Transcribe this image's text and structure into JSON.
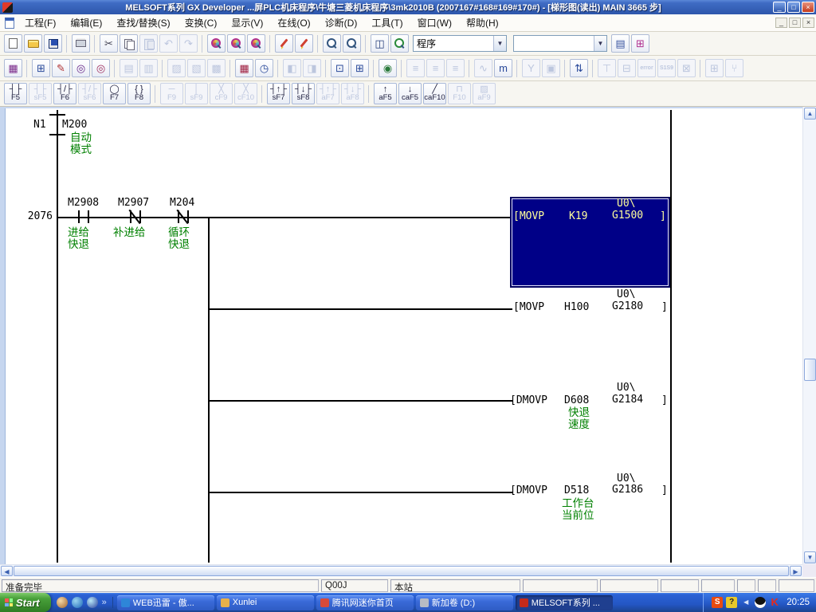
{
  "window": {
    "title": "MELSOFT系列 GX Developer ...屏PLC机床程序\\牛塘三菱机床程序\\3mk2010B    (2007167#168#169#170#) - [梯形图(读出)    MAIN    3665 步]",
    "controls": {
      "minimize": "_",
      "restore": "□",
      "close": "×"
    }
  },
  "menu": {
    "items": [
      "工程(F)",
      "编辑(E)",
      "查找/替换(S)",
      "变换(C)",
      "显示(V)",
      "在线(O)",
      "诊断(D)",
      "工具(T)",
      "窗口(W)",
      "帮助(H)"
    ],
    "mdi_controls": {
      "minimize": "_",
      "restore": "□",
      "close": "×"
    }
  },
  "toolbar_main": {
    "buttons": [
      {
        "name": "new-project",
        "icon": "page",
        "enabled": true
      },
      {
        "name": "open-project",
        "icon": "folder",
        "enabled": true
      },
      {
        "name": "save-project",
        "icon": "floppy",
        "enabled": true
      },
      {
        "sep": true
      },
      {
        "name": "print",
        "icon": "printer",
        "enabled": true
      },
      {
        "sep": true
      },
      {
        "name": "cut",
        "icon": "glyph:✂",
        "enabled": true,
        "color": "#445"
      },
      {
        "name": "copy",
        "icon": "copy",
        "enabled": true
      },
      {
        "name": "paste",
        "icon": "paste",
        "enabled": false
      },
      {
        "name": "undo",
        "icon": "glyph:↶",
        "enabled": false
      },
      {
        "name": "redo",
        "icon": "glyph:↷",
        "enabled": false
      },
      {
        "sep": true
      },
      {
        "name": "find",
        "icon": "mag-colorful",
        "enabled": true
      },
      {
        "name": "find-device",
        "icon": "mag-colorful",
        "enabled": true
      },
      {
        "name": "find-string",
        "icon": "mag-colorful",
        "enabled": true
      },
      {
        "sep": true
      },
      {
        "name": "device-comment-edit",
        "icon": "pencil",
        "enabled": true
      },
      {
        "name": "device-memory-edit",
        "icon": "pencil",
        "enabled": true
      },
      {
        "sep": true
      },
      {
        "name": "zoom-out",
        "icon": "mag",
        "enabled": true
      },
      {
        "name": "zoom-in",
        "icon": "mag",
        "enabled": true
      },
      {
        "sep": true
      },
      {
        "name": "tile-windows",
        "icon": "glyph:◫",
        "enabled": true
      },
      {
        "name": "refresh-monitor",
        "icon": "mag-green",
        "enabled": true
      }
    ],
    "program_combo_value": "程序",
    "find_combo_value": "",
    "after_buttons": [
      {
        "name": "verify-document",
        "icon": "glyph:▤",
        "enabled": true,
        "color": "#3a55a0"
      },
      {
        "name": "project-structure",
        "icon": "glyph:⊞",
        "enabled": true,
        "color": "#b03090"
      }
    ]
  },
  "toolbar_second": {
    "buttons": [
      {
        "name": "ladder-list-toggle",
        "glyph": "▦",
        "enabled": true,
        "color": "#7a2a8a"
      },
      {
        "sep": true
      },
      {
        "name": "project-data-list",
        "glyph": "⊞",
        "enabled": true,
        "color": "#2a4a9a"
      },
      {
        "name": "data-edit-marker",
        "glyph": "✎",
        "enabled": true,
        "color": "#b03030"
      },
      {
        "name": "find-contact-coil",
        "glyph": "◎",
        "enabled": true,
        "color": "#6a2a8a"
      },
      {
        "name": "find-device-edit",
        "glyph": "◎",
        "enabled": true,
        "color": "#a03060"
      },
      {
        "sep": true
      },
      {
        "name": "comment-display",
        "glyph": "▤",
        "enabled": false
      },
      {
        "name": "statement-display",
        "glyph": "▥",
        "enabled": false
      },
      {
        "sep": true
      },
      {
        "name": "inline-statement-edit",
        "glyph": "▨",
        "enabled": false
      },
      {
        "name": "note-edit",
        "glyph": "▧",
        "enabled": false
      },
      {
        "name": "declaration-edit",
        "glyph": "▩",
        "enabled": false
      },
      {
        "sep": true
      },
      {
        "name": "program-check",
        "glyph": "▦",
        "enabled": true,
        "color": "#a02040"
      },
      {
        "name": "time-monitor",
        "glyph": "◷",
        "enabled": true,
        "color": "#2a4a9a"
      },
      {
        "sep": true
      },
      {
        "name": "monitor-write",
        "glyph": "◧",
        "enabled": false
      },
      {
        "name": "monitor-stop",
        "glyph": "◨",
        "enabled": false
      },
      {
        "sep": true
      },
      {
        "name": "open-window-jump",
        "glyph": "⊡",
        "enabled": true,
        "color": "#2a4a9a"
      },
      {
        "name": "open-window-new",
        "glyph": "⊞",
        "enabled": true,
        "color": "#2a4a9a"
      },
      {
        "sep": true
      },
      {
        "name": "online-monitor",
        "glyph": "◉",
        "enabled": true,
        "color": "#2a7a3a"
      },
      {
        "sep": true
      },
      {
        "name": "ladder-step-1",
        "glyph": "≡",
        "enabled": false
      },
      {
        "name": "ladder-step-2",
        "glyph": "≡",
        "enabled": false
      },
      {
        "name": "ladder-step-3",
        "glyph": "≡",
        "enabled": false
      },
      {
        "sep": true
      },
      {
        "name": "sampling-trace",
        "glyph": "∿",
        "enabled": false
      },
      {
        "name": "monitor-m",
        "glyph": "m",
        "enabled": true,
        "color": "#2a4a9a"
      },
      {
        "sep": true
      },
      {
        "name": "tree-branch",
        "glyph": "Y",
        "enabled": false
      },
      {
        "name": "cross-reference",
        "glyph": "▣",
        "enabled": false
      },
      {
        "sep": true
      },
      {
        "name": "document-transfer",
        "glyph": "⇅",
        "enabled": true,
        "color": "#2a4a9a"
      },
      {
        "sep": true
      },
      {
        "name": "label-down",
        "glyph": "⊤",
        "enabled": false
      },
      {
        "name": "pages-copy",
        "glyph": "⊟",
        "enabled": false
      },
      {
        "name": "error-jump",
        "glyph": "error",
        "small": true,
        "enabled": false
      },
      {
        "name": "sfc-step",
        "glyph": "S1S9",
        "small": true,
        "enabled": false
      },
      {
        "name": "block-flag",
        "glyph": "⊠",
        "enabled": false
      },
      {
        "sep": true
      },
      {
        "name": "grid-window",
        "glyph": "⊞",
        "enabled": false
      },
      {
        "name": "tree-down",
        "glyph": "⑂",
        "enabled": false
      }
    ]
  },
  "toolbar_ladder": {
    "buttons": [
      {
        "name": "open-contact",
        "glyph": "┤├",
        "label": "F5",
        "enabled": true
      },
      {
        "name": "parallel-open-contact",
        "glyph": "┤├",
        "label": "sF5",
        "enabled": false
      },
      {
        "name": "closed-contact",
        "glyph": "┤/├",
        "label": "F6",
        "enabled": true
      },
      {
        "name": "parallel-closed-contact",
        "glyph": "┤/├",
        "label": "sF6",
        "enabled": false
      },
      {
        "name": "coil",
        "glyph": "◯",
        "label": "F7",
        "enabled": true
      },
      {
        "name": "application-instruction",
        "glyph": "{ }",
        "label": "F8",
        "enabled": true
      },
      {
        "sep": true
      },
      {
        "name": "horizontal-line",
        "glyph": "─",
        "label": "F9",
        "enabled": false
      },
      {
        "name": "vertical-line",
        "glyph": "│",
        "label": "sF9",
        "enabled": false
      },
      {
        "name": "delete-horizontal-line",
        "glyph": "╳",
        "label": "cF9",
        "enabled": false
      },
      {
        "name": "delete-vertical-line",
        "glyph": "╳",
        "label": "cF10",
        "enabled": false
      },
      {
        "sep": true
      },
      {
        "name": "rising-pulse",
        "glyph": "┤↑├",
        "label": "sF7",
        "enabled": true
      },
      {
        "name": "falling-pulse",
        "glyph": "┤↓├",
        "label": "sF8",
        "enabled": true
      },
      {
        "name": "parallel-rising-pulse",
        "glyph": "┤↑├",
        "label": "aF7",
        "enabled": false
      },
      {
        "name": "parallel-falling-pulse",
        "glyph": "┤↓├",
        "label": "aF8",
        "enabled": false
      },
      {
        "sep": true
      },
      {
        "name": "pulse-up",
        "glyph": "↑",
        "label": "aF5",
        "enabled": true
      },
      {
        "name": "pulse-down",
        "glyph": "↓",
        "label": "caF5",
        "enabled": true
      },
      {
        "name": "invert-operation",
        "glyph": "╱",
        "label": "caF10",
        "enabled": true
      },
      {
        "name": "branch-line",
        "glyph": "⊓",
        "label": "F10",
        "enabled": false
      },
      {
        "name": "delete-branch",
        "glyph": "▨",
        "label": "aF9",
        "enabled": false
      }
    ]
  },
  "ladder": {
    "nest": {
      "label": "N1",
      "device": "M200",
      "comment_line1": "自动",
      "comment_line2": "模式"
    },
    "step_number": "2076",
    "contacts": [
      {
        "device": "M2908",
        "type": "open",
        "comment_line1": "进给",
        "comment_line2": "快退"
      },
      {
        "device": "M2907",
        "type": "closed",
        "comment_line1": "补进给",
        "comment_line2": ""
      },
      {
        "device": "M204",
        "type": "closed",
        "comment_line1": "循环",
        "comment_line2": "快退"
      }
    ],
    "instructions": [
      {
        "op": "[MOVP",
        "source": "K19",
        "dest_line1": "U0\\",
        "dest_line2": "G1500",
        "bracket": "]",
        "selected": true
      },
      {
        "op": "[MOVP",
        "source": "H100",
        "dest_line1": "U0\\",
        "dest_line2": "G2180",
        "bracket": "]"
      },
      {
        "op": "[DMOVP",
        "source": "D608",
        "dest_line1": "U0\\",
        "dest_line2": "G2184",
        "bracket": "]",
        "source_comment_line1": "快退",
        "source_comment_line2": "速度"
      },
      {
        "op": "[DMOVP",
        "source": "D518",
        "dest_line1": "U0\\",
        "dest_line2": "G2186",
        "bracket": "]",
        "source_comment_line1": "工作台",
        "source_comment_line2": "当前位"
      }
    ]
  },
  "status_bar": {
    "ready": "准备完毕",
    "plc_type": "Q00J",
    "station": "本站"
  },
  "taskbar": {
    "start_label": "Start",
    "quicklaunch_chevron": "»",
    "tasks": [
      {
        "label": "WEB迅雷 - 傲...",
        "icon_color": "#2e86d8",
        "active": false
      },
      {
        "label": "Xunlei",
        "icon_color": "#e8b04a",
        "active": false
      },
      {
        "label": "腾讯网迷你首页",
        "icon_color": "#d84a3a",
        "active": false
      },
      {
        "label": "新加卷 (D:)",
        "icon_color": "#b8bcc4",
        "active": false
      },
      {
        "label": "MELSOFT系列 ...",
        "icon_color": "#c42a1a",
        "active": true
      }
    ],
    "tray": {
      "sogou": "S",
      "ime_help": "?",
      "hide_chevron": "◀",
      "kaspersky": "K",
      "time": "20:25"
    }
  },
  "colors": {
    "selection_block": "#000087",
    "comment_green": "#008000",
    "selected_text": "#ffff9c"
  }
}
